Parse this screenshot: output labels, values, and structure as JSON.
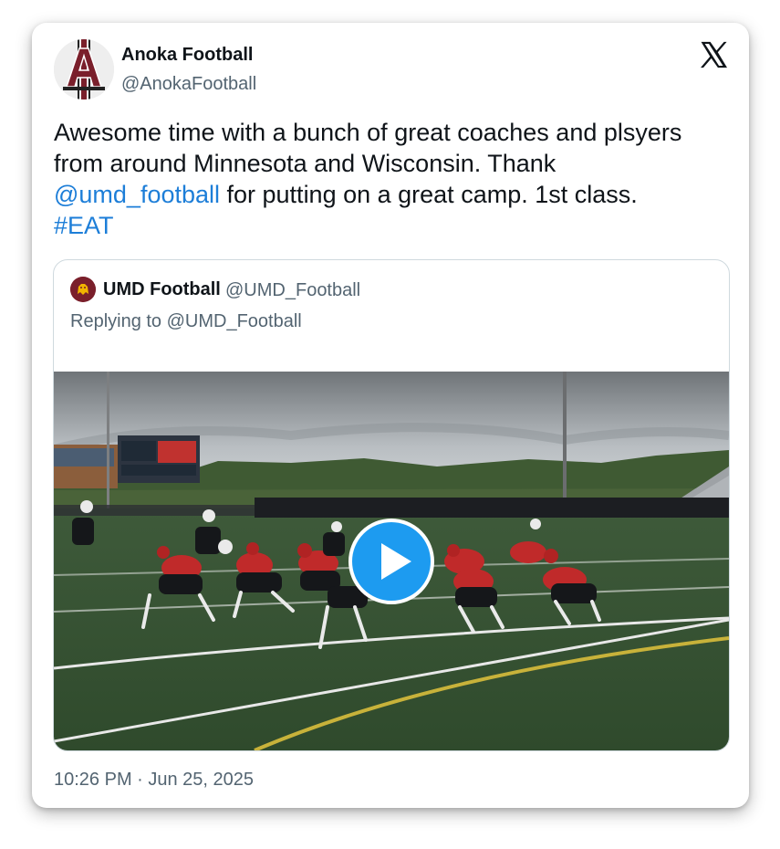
{
  "author": {
    "name": "Anoka Football",
    "handle": "@AnokaFootball",
    "avatar_icon": "anoka-a-logo-icon"
  },
  "tweet": {
    "line1": "Awesome time with a bunch of great coaches and plsyers",
    "line2": "from around Minnesota and Wisconsin. Thank",
    "mention": "@umd_football",
    "line3_rest": " for putting on a great camp. 1st class.",
    "hashtag": "#EAT"
  },
  "quote": {
    "name": "UMD Football",
    "handle": "@UMD_Football",
    "replying_to": "Replying to @UMD_Football",
    "avatar_icon": "umd-bulldog-logo-icon"
  },
  "video": {
    "thumbnail_icon": "football-practice-thumbnail",
    "play_icon": "play-icon"
  },
  "timestamp": "10:26 PM · Jun 25, 2025",
  "colors": {
    "link": "#1d7ed8",
    "play_button": "#1d9bf0",
    "anoka_maroon": "#7a1f2b",
    "secondary_text": "#536471"
  }
}
